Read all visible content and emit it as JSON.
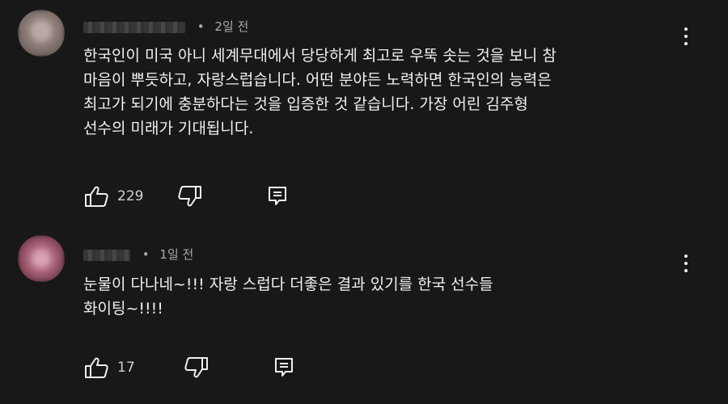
{
  "comments": [
    {
      "avatar_color": "#8a7a76",
      "time": "2일 전",
      "separator": "•",
      "lines": [
        "한국인이 미국 아니 세계무대에서 당당하게 최고로 우뚝 솟는 것을 보니 참",
        "마음이 뿌듯하고, 자랑스럽습니다. 어떤 분야든 노력하면 한국인의 능력은",
        "최고가 되기에 충분하다는 것을 입증한 것 같습니다. 가장 어린 김주형",
        "선수의 미래가 기대됩니다."
      ],
      "likes": "229",
      "icons": {
        "like": "thumbs-up-icon",
        "dislike": "thumbs-down-icon",
        "reply": "reply-icon",
        "menu": "more-vert-icon"
      }
    },
    {
      "avatar_color": "#a06070",
      "time": "1일 전",
      "separator": "•",
      "lines": [
        "눈물이 다나네~!!! 자랑 스럽다 더좋은 결과 있기를 한국 선수들",
        "화이팅~!!!!"
      ],
      "likes": "17",
      "icons": {
        "like": "thumbs-up-icon",
        "dislike": "thumbs-down-icon",
        "reply": "reply-icon",
        "menu": "more-vert-icon"
      }
    }
  ]
}
